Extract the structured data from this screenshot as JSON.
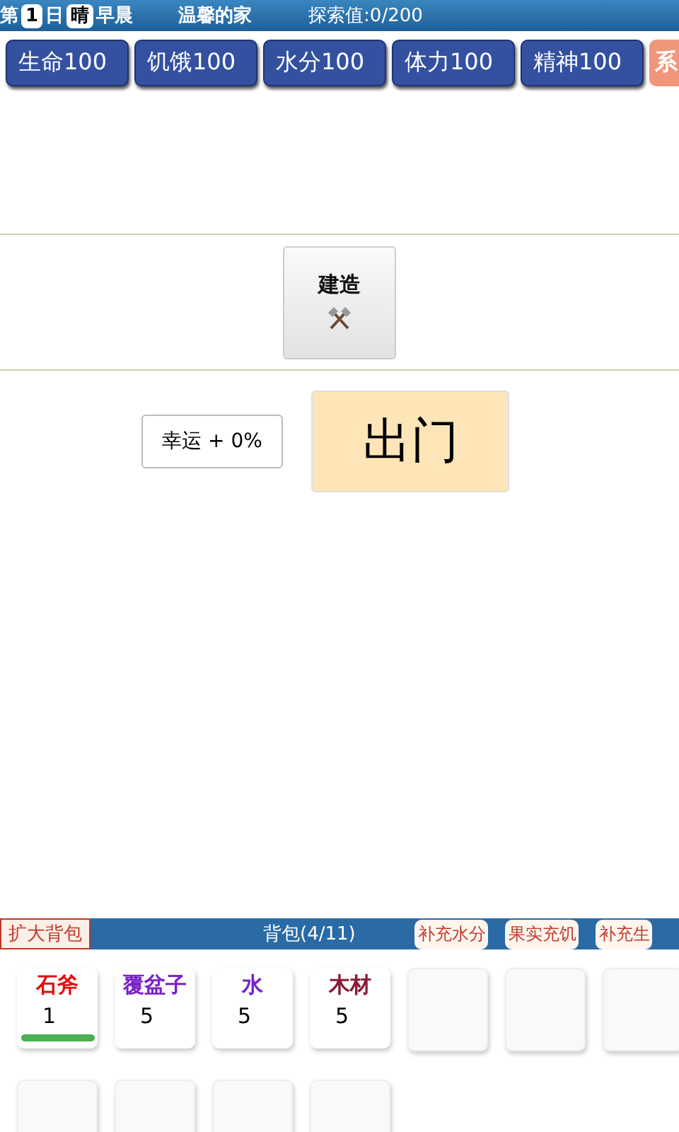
{
  "status_bar": {
    "day_prefix": "第",
    "day": "1",
    "day_suffix": "日",
    "weather": "晴",
    "time_of_day": "早晨",
    "location": "温馨的家",
    "exploration": "探索值:0/200"
  },
  "stats": [
    {
      "label": "生命100",
      "kind": "stat"
    },
    {
      "label": "饥饿100",
      "kind": "stat"
    },
    {
      "label": "水分100",
      "kind": "stat"
    },
    {
      "label": "体力100",
      "kind": "stat"
    },
    {
      "label": "精神100",
      "kind": "stat"
    },
    {
      "label": "系",
      "kind": "system"
    }
  ],
  "build_button": {
    "label": "建造"
  },
  "luck": "幸运 + 0%",
  "go_out_button": {
    "label": "出门"
  },
  "backpack": {
    "expand_button": "扩大背包",
    "title": "背包(4/11)",
    "quick_actions": [
      "补充水分",
      "果实充饥",
      "补充生"
    ]
  },
  "slots": [
    {
      "kind": "item",
      "name": "石斧",
      "color": "#e01010",
      "count": "1",
      "level": 1
    },
    {
      "kind": "item",
      "name": "覆盆子",
      "color": "#7a22c8",
      "count": "5"
    },
    {
      "kind": "item",
      "name": "水",
      "color": "#7a22c8",
      "count": "5"
    },
    {
      "kind": "item",
      "name": "木材",
      "color": "#8a1a3a",
      "count": "5"
    },
    {
      "kind": "empty"
    },
    {
      "kind": "empty"
    },
    {
      "kind": "empty"
    },
    {
      "kind": "empty"
    },
    {
      "kind": "empty"
    },
    {
      "kind": "empty"
    },
    {
      "kind": "empty"
    }
  ]
}
